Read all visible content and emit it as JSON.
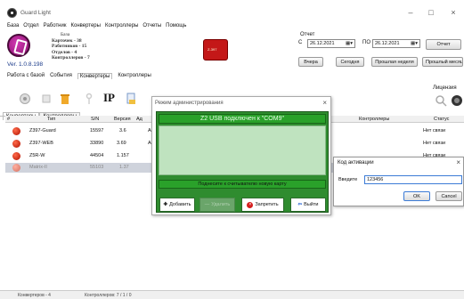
{
  "window": {
    "title": "Guard Light",
    "minimize": "–",
    "maximize": "□",
    "close": "×"
  },
  "menu": [
    "База",
    "Отдел",
    "Работник",
    "Конвертеры",
    "Контроллеры",
    "Отчеты",
    "Помощь"
  ],
  "stats": {
    "db": "База",
    "cards": "Карточек - 38",
    "workers": "Работников - 15",
    "departments": "Отделов - 4",
    "controllers": "Контроллеров - 7"
  },
  "version": "Ver. 1.0.8.198",
  "report": {
    "label": "Отчет",
    "from_label": "С",
    "to_label": "ПО",
    "date_from": "26.12.2021",
    "date_to": "26.12.2021",
    "picker": "▦▾",
    "btn_report": "Отчет",
    "btn_yesterday": "Вчера",
    "btn_today": "Сегодня",
    "btn_last_week": "Прошлая неделя",
    "btn_last_month": "Прошлый месяц"
  },
  "top_tabs": [
    "Работа с базой",
    "События",
    "Конвертеры",
    "Контроллеры"
  ],
  "search_label": "Лицензия",
  "table": {
    "columns": {
      "num": "#",
      "type": "Тип",
      "sn": "S/N",
      "version": "Версия",
      "extra": "Ад",
      "controllers": "Контроллеры",
      "status": "Статус"
    },
    "rows": [
      {
        "type": "Z397-Guard",
        "sn": "15597",
        "version": "3.6",
        "extra": "Ad",
        "status": "Нет связи"
      },
      {
        "type": "Z397-WEB",
        "sn": "33890",
        "version": "3.69",
        "extra": "Ad",
        "status": "Нет связи"
      },
      {
        "type": "Z5R-W",
        "sn": "44504",
        "version": "1.157",
        "extra": "",
        "status": "Нет связи"
      },
      {
        "type": "Matrix-II",
        "sn": "55103",
        "version": "1.37",
        "extra": "",
        "status": ""
      }
    ]
  },
  "statusbar": {
    "left": "Конвертеров - 4",
    "right": "Контроллеров: 7 / 1 / 0"
  },
  "admin_dialog": {
    "title": "Режим администрирования",
    "header": "Z2 USB подключен к \"COM9\"",
    "hint": "Поднесите к считывателю новую карту",
    "btn_add": "Добавить",
    "btn_delete": "Удалить",
    "btn_forbid": "Запретить",
    "btn_exit": "Выйти"
  },
  "code_dialog": {
    "title": "Код активации",
    "label": "Введите",
    "value": "123456",
    "ok": "OK",
    "cancel": "Cancel"
  },
  "colors": {
    "admin_green": "#2f8c2f",
    "row_ball": "#e0301a",
    "selected_row": "#cfd3dc"
  }
}
